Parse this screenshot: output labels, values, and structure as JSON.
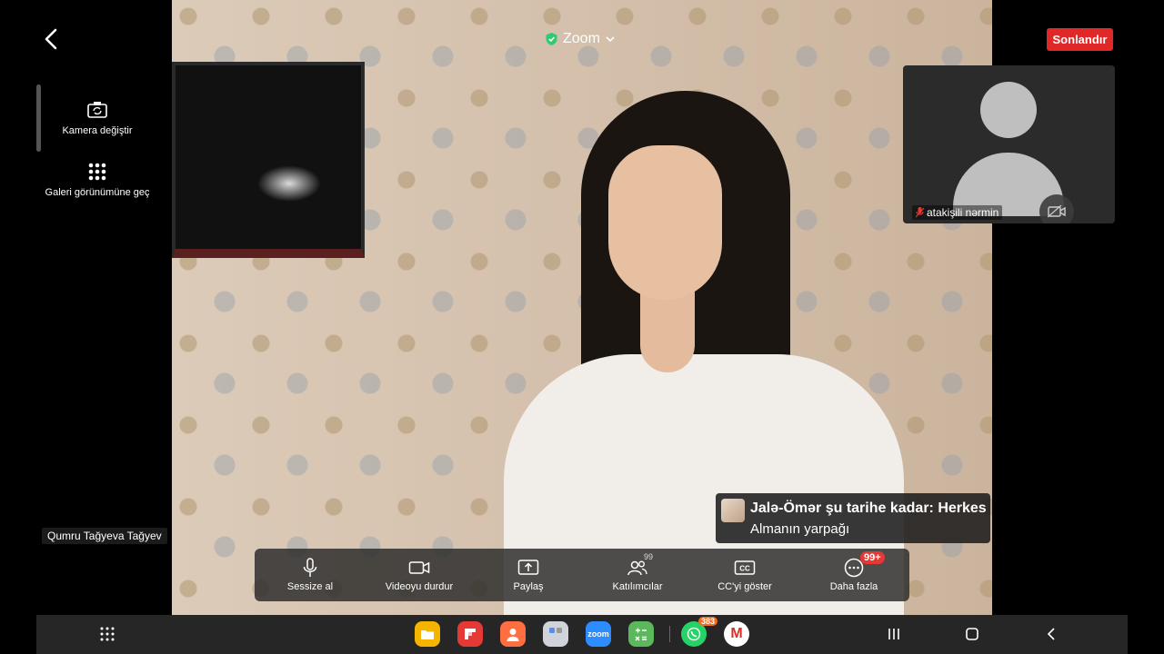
{
  "app": {
    "title": "Zoom",
    "end_label": "Sonlandır",
    "accent": "#e02828",
    "secure_color": "#2ecc71"
  },
  "side": {
    "camera_label": "Kamera değiştir",
    "gallery_label": "Galeri görünümüne geç"
  },
  "thumbnail": {
    "participant_name": "atakişili nərmin",
    "muted_icon": "mic-off-icon",
    "video_off_icon": "camera-off-icon"
  },
  "speaker": {
    "name": "Qumru Tağyeva Tağyev"
  },
  "chat_toast": {
    "sender": "Jalə-Ömər şu tarihe kadar: Herkes",
    "message": "Almanın yarpağı"
  },
  "controls": {
    "mute": "Sessize al",
    "video": "Videoyu durdur",
    "share": "Paylaş",
    "participants": "Katılımcılar",
    "participants_count": "99",
    "captions": "CC'yi göster",
    "more": "Daha fazla",
    "more_badge": "99+"
  },
  "dock": {
    "zoom_app_label": "zoom",
    "whatsapp_badge": "383",
    "gmail_letter": "M",
    "colors": {
      "files": "#f5b400",
      "flipboard": "#e53935",
      "contacts": "#ff6e40",
      "zoom": "#2d8cff",
      "calculator": "#5cb85c",
      "whatsapp": "#25d366",
      "gmail": "#ffffff"
    }
  }
}
